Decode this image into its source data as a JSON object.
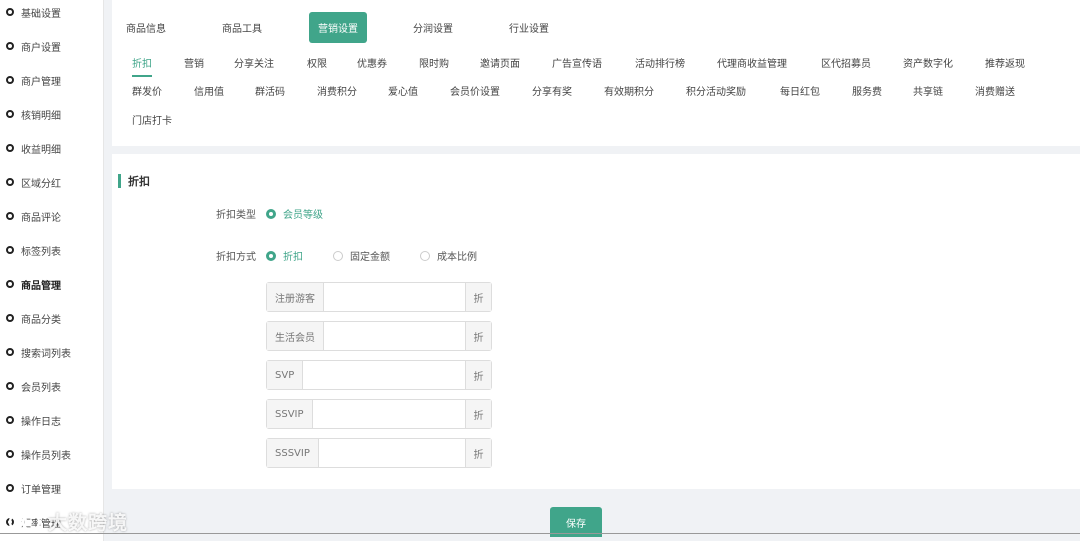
{
  "sidebar": {
    "items": [
      {
        "label": "基础设置"
      },
      {
        "label": "商户设置"
      },
      {
        "label": "商户管理"
      },
      {
        "label": "核销明细"
      },
      {
        "label": "收益明细"
      },
      {
        "label": "区域分红"
      },
      {
        "label": "商品评论"
      },
      {
        "label": "标签列表"
      },
      {
        "label": "商品管理"
      },
      {
        "label": "商品分类"
      },
      {
        "label": "搜索词列表"
      },
      {
        "label": "会员列表"
      },
      {
        "label": "操作日志"
      },
      {
        "label": "操作员列表"
      },
      {
        "label": "订单管理"
      },
      {
        "label": "汇率管理"
      }
    ],
    "active_index": 8
  },
  "main_tabs": [
    {
      "label": "商品信息"
    },
    {
      "label": "商品工具"
    },
    {
      "label": "营销设置"
    },
    {
      "label": "分润设置"
    },
    {
      "label": "行业设置"
    }
  ],
  "main_tab_active": 2,
  "sub_tabs": [
    {
      "label": "折扣"
    },
    {
      "label": "营销"
    },
    {
      "label": "分享关注"
    },
    {
      "label": "权限"
    },
    {
      "label": "优惠券"
    },
    {
      "label": "限时购"
    },
    {
      "label": "邀请页面"
    },
    {
      "label": "广告宣传语"
    },
    {
      "label": "活动排行榜"
    },
    {
      "label": "代理商收益管理"
    },
    {
      "label": "区代招募员"
    },
    {
      "label": "资产数字化"
    },
    {
      "label": "推荐返现"
    },
    {
      "label": "群发价"
    },
    {
      "label": "信用值"
    },
    {
      "label": "群活码"
    },
    {
      "label": "消费积分"
    },
    {
      "label": "爱心值"
    },
    {
      "label": "会员价设置"
    },
    {
      "label": "分享有奖"
    },
    {
      "label": "有效期积分"
    },
    {
      "label": "积分活动奖励"
    },
    {
      "label": "每日红包"
    },
    {
      "label": "服务费"
    },
    {
      "label": "共享链"
    },
    {
      "label": "消费赠送"
    },
    {
      "label": "门店打卡"
    }
  ],
  "sub_tab_active": 0,
  "section": {
    "title": "折扣"
  },
  "discount_type": {
    "label": "折扣类型",
    "options": [
      {
        "label": "会员等级",
        "checked": true
      }
    ]
  },
  "discount_method": {
    "label": "折扣方式",
    "options": [
      {
        "label": "折扣",
        "checked": true
      },
      {
        "label": "固定金额",
        "checked": false
      },
      {
        "label": "成本比例",
        "checked": false
      }
    ]
  },
  "levels": [
    {
      "name": "注册游客",
      "value": "",
      "suffix": "折"
    },
    {
      "name": "生活会员",
      "value": "",
      "suffix": "折"
    },
    {
      "name": "SVP",
      "value": "",
      "suffix": "折"
    },
    {
      "name": "SSVIP",
      "value": "",
      "suffix": "折"
    },
    {
      "name": "SSSVIP",
      "value": "",
      "suffix": "折"
    }
  ],
  "save_label": "保存",
  "watermark": {
    "text": "大数跨境",
    "icon": "brand-logo-icon"
  },
  "colors": {
    "accent": "#40a58a",
    "background": "#f0f2f5"
  }
}
